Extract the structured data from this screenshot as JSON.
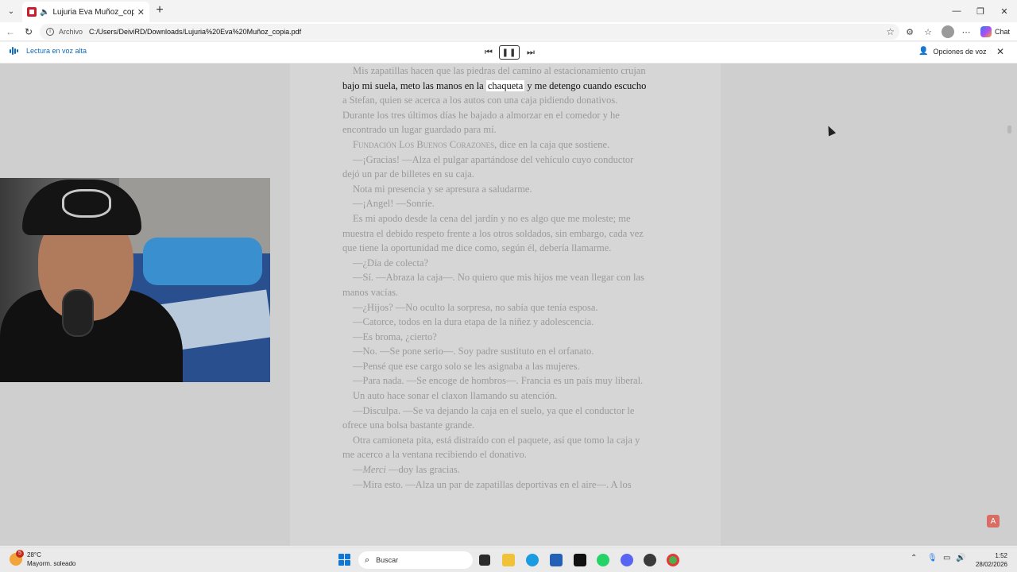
{
  "browser": {
    "tab_title": "Lujuria Eva Muñoz_copia.pdf",
    "new_tab": "+",
    "url_label": "Archivo",
    "url_path": "C:/Users/DeiviRD/Downloads/Lujuria%20Eva%20Muñoz_copia.pdf",
    "chat_label": "Chat"
  },
  "read_aloud": {
    "label": "Lectura en voz alta",
    "voice_options": "Opciones de voz"
  },
  "document": {
    "line1": "Mis zapatillas hacen que las piedras del camino al estacionamiento crujan",
    "line2_before": "bajo mi suela, meto las manos en la ",
    "line2_highlight": "chaqueta",
    "line2_after": " y me detengo cuando escucho",
    "line3": "a Stefan, quien se acerca a los autos con una caja pidiendo donativos.",
    "line4": "Durante los tres últimos días he bajado a almorzar en el comedor y he",
    "line5": "encontrado un lugar guardado para mí.",
    "line6_sc": "Fundación Los Buenos Corazones",
    "line6_rest": ", dice en la caja que sostiene.",
    "line7": "—¡Gracias! —Alza el pulgar apartándose del vehículo cuyo conductor",
    "line8": "dejó un par de billetes en su caja.",
    "line9": "Nota mi presencia y se apresura a saludarme.",
    "line10": "—¡Angel! —Sonríe.",
    "line11": "Es mi apodo desde la cena del jardín y no es algo que me moleste; me",
    "line12": "muestra el debido respeto frente a los otros soldados, sin embargo, cada vez",
    "line13": "que tiene la oportunidad me dice como, según él, debería llamarme.",
    "line14": "—¿Día de colecta?",
    "line15": "—Sí. —Abraza la caja—. No quiero que mis hijos me vean llegar con las",
    "line16": "manos vacías.",
    "line17": "—¿Hijos? —No oculto la sorpresa, no sabía que tenía esposa.",
    "line18": "—Catorce, todos en la dura etapa de la niñez y adolescencia.",
    "line19": "—Es broma, ¿cierto?",
    "line20": "—No. —Se pone serio—. Soy padre sustituto en el orfanato.",
    "line21": "—Pensé que ese cargo solo se les asignaba a las mujeres.",
    "line22": "—Para nada. —Se encoge de hombros—. Francia es un país muy liberal.",
    "line23": "Un auto hace sonar el claxon llamando su atención.",
    "line24": "—Disculpa. —Se va dejando la caja en el suelo, ya que el conductor le",
    "line25": "ofrece una bolsa bastante grande.",
    "line26": "Otra camioneta pita, está distraído con el paquete, así que tomo la caja y",
    "line27": "me acerco a la ventana recibiendo el donativo.",
    "line28_pre": "—",
    "line28_it": "Merci",
    "line28_rest": " —doy las gracias.",
    "line29": "—Mira esto. —Alza un par de zapatillas deportivas en el aire—. A los"
  },
  "taskbar": {
    "temp": "28°C",
    "weather": "Mayorm. soleado",
    "badge": "5",
    "search_placeholder": "Buscar",
    "time": "1:52",
    "date": "28/02/2026"
  },
  "colors": {
    "accent": "#0f6cbd",
    "pdf_red": "#c8202f",
    "page_bg": "#d6d6d6",
    "viewer_bg": "#cfcfcf",
    "dim_text": "#9a9a9a",
    "active_text": "#111111"
  }
}
